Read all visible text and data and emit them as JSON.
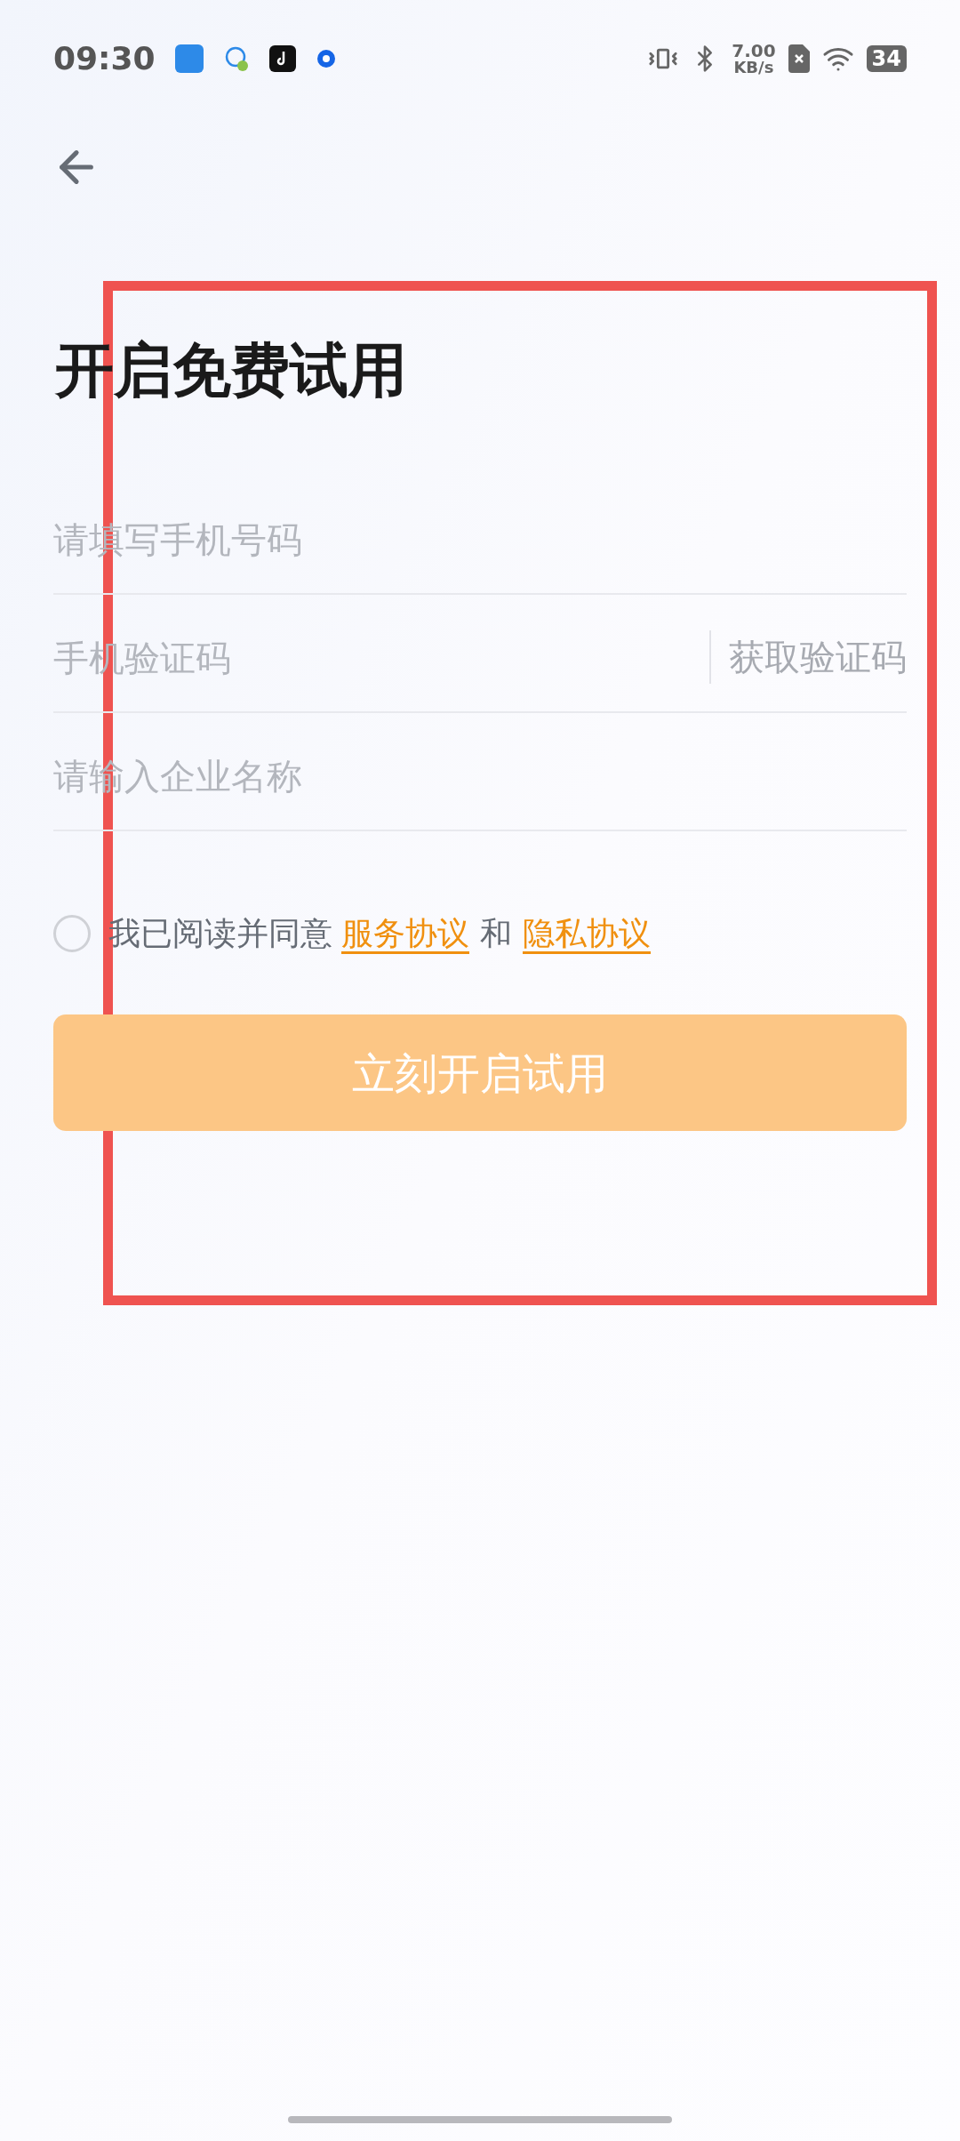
{
  "status_bar": {
    "time": "09:30",
    "speed_value": "7.00",
    "speed_unit": "KB/s",
    "battery": "34"
  },
  "title": "开启免费试用",
  "fields": [
    {
      "kind": "text",
      "placeholder": "请填写手机号码"
    },
    {
      "kind": "code",
      "placeholder": "手机验证码",
      "action": "获取验证码"
    },
    {
      "kind": "text",
      "placeholder": "请输入企业名称"
    }
  ],
  "agreement": {
    "checked": false,
    "prefix": "我已阅读并同意",
    "link_1": "服务协议",
    "joiner": "和",
    "link_2": "隐私协议"
  },
  "submit": {
    "label": "立刻开启试用",
    "disabled": true
  }
}
